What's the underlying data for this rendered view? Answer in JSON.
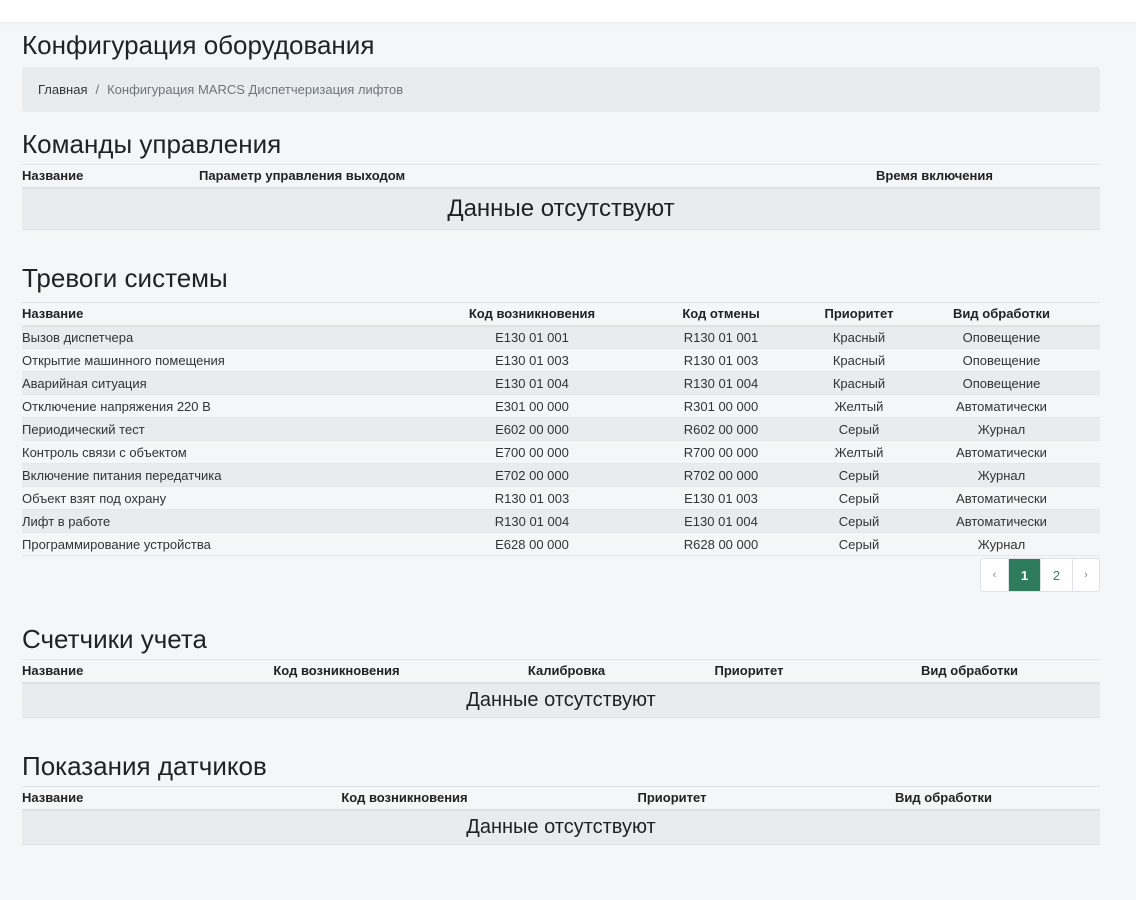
{
  "page": {
    "title": "Конфигурация оборудования"
  },
  "breadcrumb": {
    "home": "Главная",
    "separator": "/",
    "current": "Конфигурация MARCS Диспетчеризация лифтов"
  },
  "commands": {
    "title": "Команды управления",
    "columns": [
      "Название",
      "Параметр управления выходом",
      "Время включения"
    ],
    "empty": "Данные отсутствуют"
  },
  "alarms": {
    "title": "Тревоги системы",
    "columns": [
      "Название",
      "Код возникновения",
      "Код отмены",
      "Приоритет",
      "Вид обработки"
    ],
    "rows": [
      [
        "Вызов диспетчера",
        "E130 01 001",
        "R130 01 001",
        "Красный",
        "Оповещение"
      ],
      [
        "Открытие машинного помещения",
        "E130 01 003",
        "R130 01 003",
        "Красный",
        "Оповещение"
      ],
      [
        "Аварийная ситуация",
        "E130 01 004",
        "R130 01 004",
        "Красный",
        "Оповещение"
      ],
      [
        "Отключение напряжения 220 В",
        "E301 00 000",
        "R301 00 000",
        "Желтый",
        "Автоматически"
      ],
      [
        "Периодический тест",
        "E602 00 000",
        "R602 00 000",
        "Серый",
        "Журнал"
      ],
      [
        "Контроль связи с объектом",
        "E700 00 000",
        "R700 00 000",
        "Желтый",
        "Автоматически"
      ],
      [
        "Включение питания передатчика",
        "E702 00 000",
        "R702 00 000",
        "Серый",
        "Журнал"
      ],
      [
        "Объект взят под охрану",
        "R130 01 003",
        "E130 01 003",
        "Серый",
        "Автоматически"
      ],
      [
        "Лифт в работе",
        "R130 01 004",
        "E130 01 004",
        "Серый",
        "Автоматически"
      ],
      [
        "Программирование устройства",
        "E628 00 000",
        "R628 00 000",
        "Серый",
        "Журнал"
      ]
    ],
    "pagination": {
      "prev": "‹",
      "pages": [
        "1",
        "2"
      ],
      "current_page": 1,
      "next": "›"
    }
  },
  "counters": {
    "title": "Счетчики учета",
    "columns": [
      "Название",
      "Код возникновения",
      "Калибровка",
      "Приоритет",
      "Вид обработки"
    ],
    "empty": "Данные отсутствуют"
  },
  "sensors": {
    "title": "Показания датчиков",
    "columns": [
      "Название",
      "Код возникновения",
      "Приоритет",
      "Вид обработки"
    ],
    "empty": "Данные отсутствуют"
  },
  "colors": {
    "active_page": "#2f7b5e",
    "stripe": "#e9ebee",
    "breadcrumb_bg": "#e9ecef"
  }
}
